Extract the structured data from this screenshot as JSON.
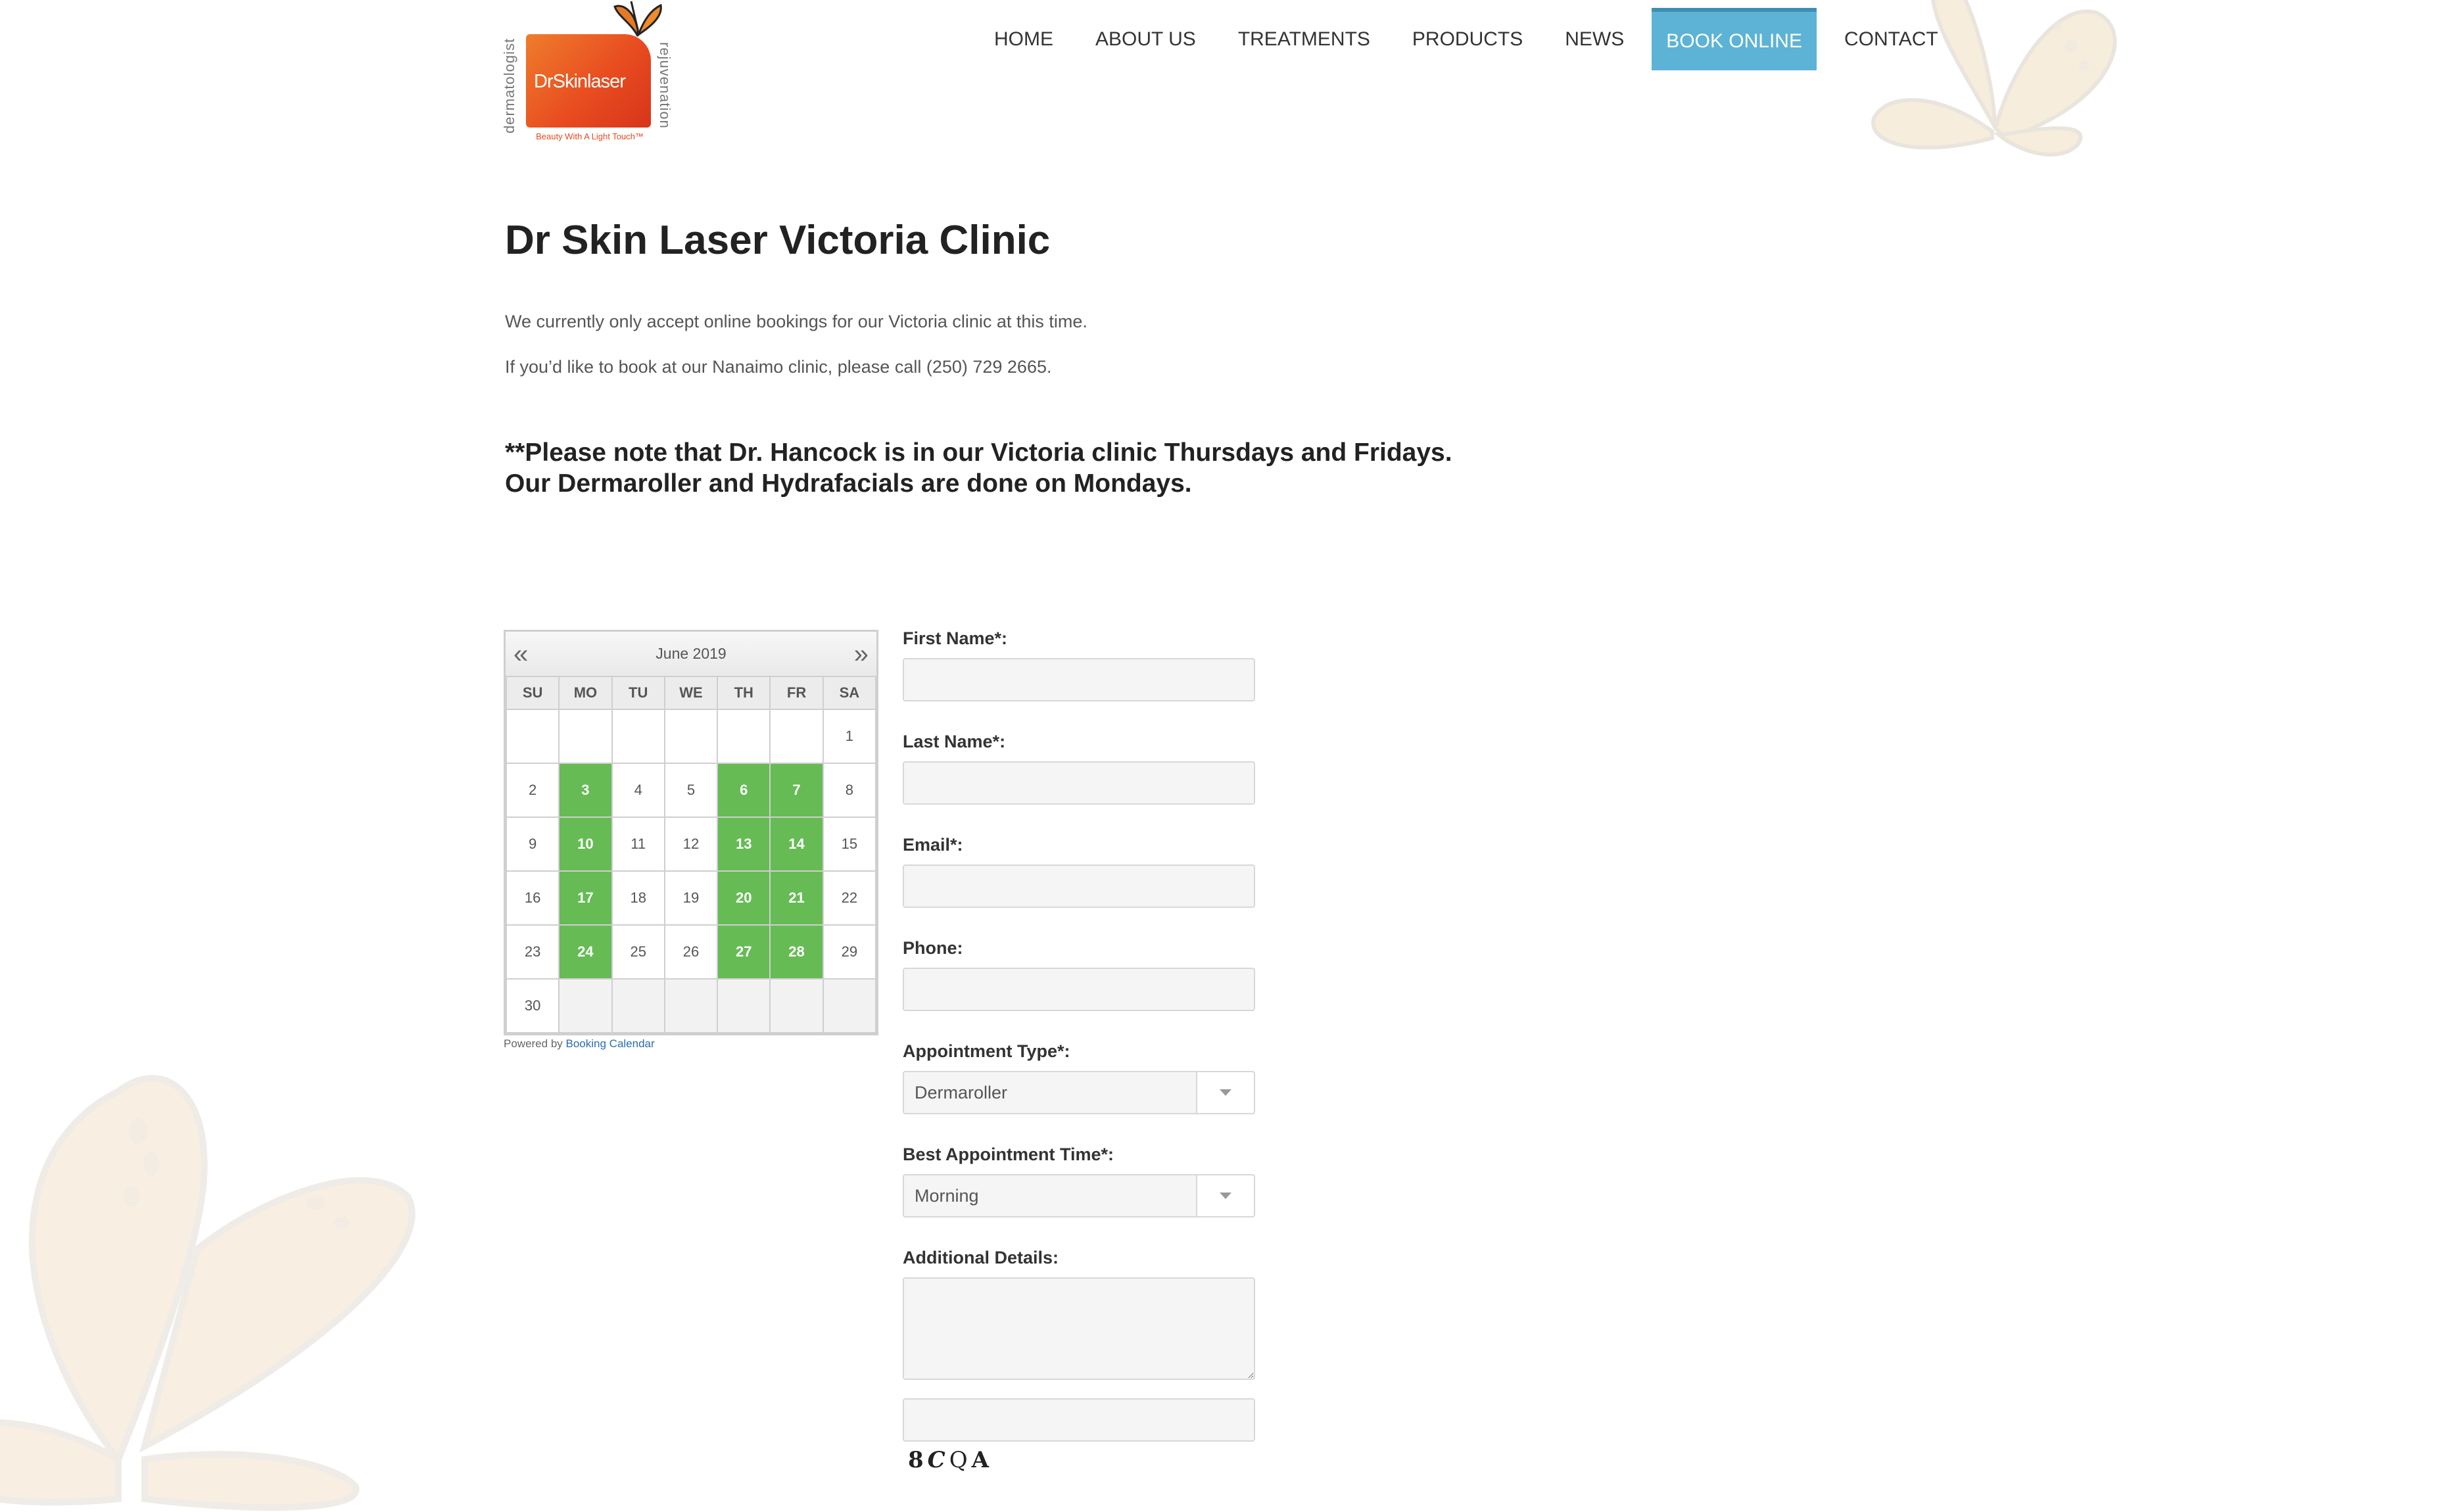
{
  "logo": {
    "brand": "DrSkinlaser",
    "left_text": "dermatologist",
    "right_text": "rejuvenation",
    "tagline": "Beauty With A Light Touch™",
    "accent_color": "#e84d20"
  },
  "nav": {
    "items": [
      {
        "label": "HOME"
      },
      {
        "label": "ABOUT US"
      },
      {
        "label": "TREATMENTS"
      },
      {
        "label": "PRODUCTS"
      },
      {
        "label": "NEWS"
      },
      {
        "label": "BOOK ONLINE",
        "active": true
      },
      {
        "label": "CONTACT"
      }
    ],
    "active_color": "#5db3d5"
  },
  "page": {
    "title": "Dr Skin Laser Victoria Clinic",
    "intro1": "We currently only accept online bookings for our Victoria clinic at this time.",
    "intro2": "If you’d like to book at our Nanaimo clinic, please call  (250) 729 2665.",
    "note_line1": "**Please note that Dr. Hancock is in our Victoria clinic Thursdays and Fridays.",
    "note_line2": "Our Dermaroller and Hydrafacials are done on Mondays."
  },
  "calendar": {
    "prev_icon": "double-chevron-left-icon",
    "next_icon": "double-chevron-right-icon",
    "prev": "«",
    "next": "»",
    "month": "June 2019",
    "weekdays": [
      "SU",
      "MO",
      "TU",
      "WE",
      "TH",
      "FR",
      "SA"
    ],
    "weeks": [
      [
        "",
        "",
        "",
        "",
        "",
        "",
        "1"
      ],
      [
        "2",
        "3",
        "4",
        "5",
        "6",
        "7",
        "8"
      ],
      [
        "9",
        "10",
        "11",
        "12",
        "13",
        "14",
        "15"
      ],
      [
        "16",
        "17",
        "18",
        "19",
        "20",
        "21",
        "22"
      ],
      [
        "23",
        "24",
        "25",
        "26",
        "27",
        "28",
        "29"
      ],
      [
        "30",
        "",
        "",
        "",
        "",
        "",
        ""
      ]
    ],
    "available_days": [
      "3",
      "6",
      "7",
      "10",
      "13",
      "14",
      "17",
      "20",
      "21",
      "24",
      "27",
      "28"
    ],
    "available_color": "#66bb55",
    "powered_by": "Powered by",
    "powered_link": "Booking Calendar"
  },
  "form": {
    "first_name_label": "First Name*:",
    "last_name_label": "Last Name*:",
    "email_label": "Email*:",
    "phone_label": "Phone:",
    "appointment_type_label": "Appointment Type*:",
    "appointment_type_value": "Dermaroller",
    "best_time_label": "Best Appointment Time*:",
    "best_time_value": "Morning",
    "details_label": "Additional Details:",
    "captcha_chars": [
      "8",
      "C",
      "Q",
      "A"
    ]
  }
}
